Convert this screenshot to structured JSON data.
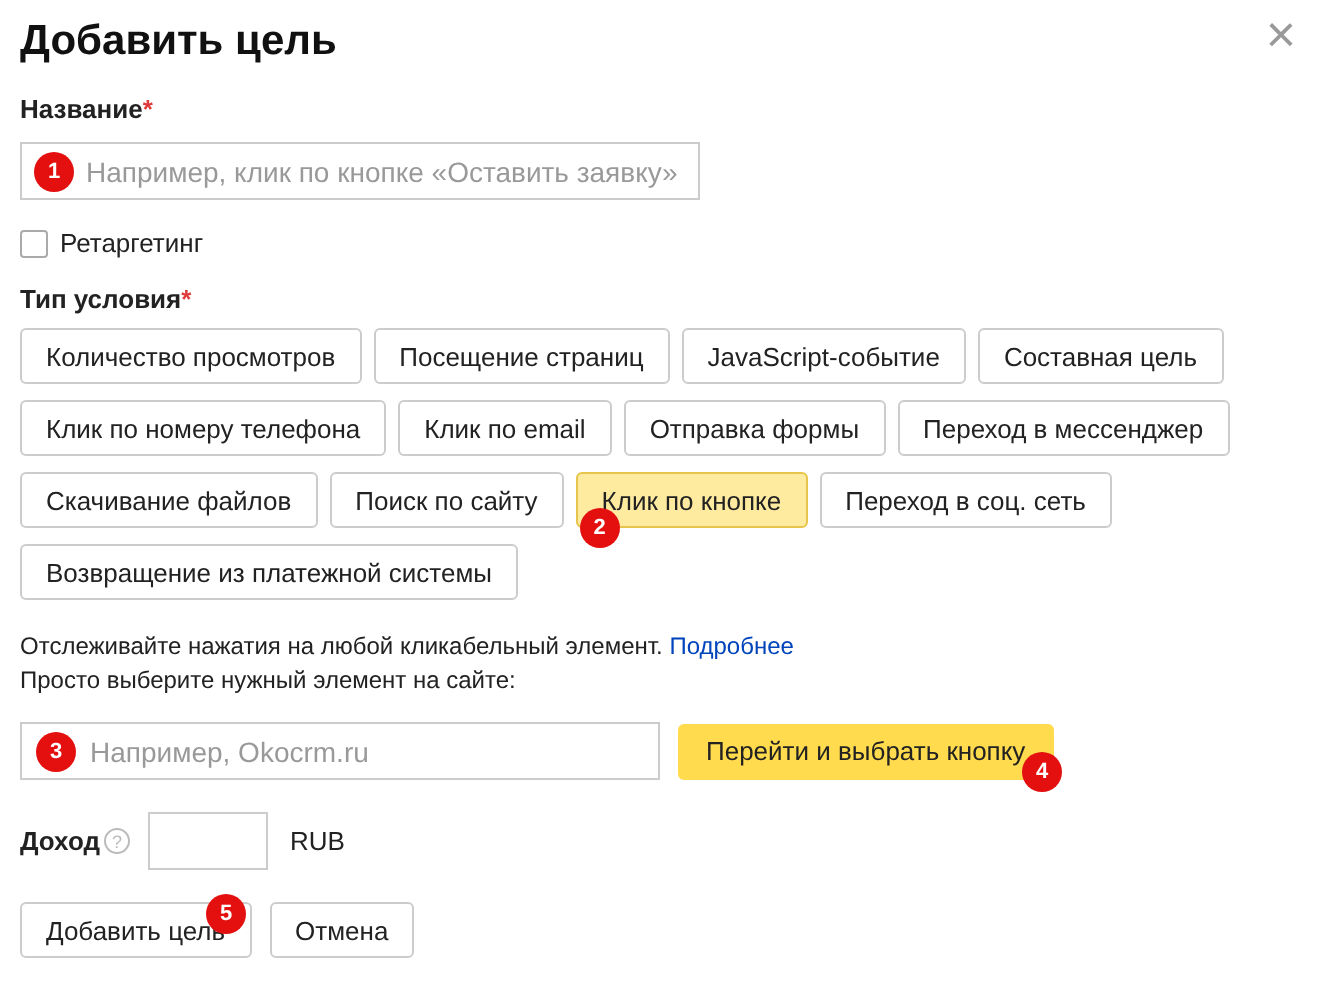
{
  "dialog": {
    "title": "Добавить цель",
    "close_icon": "×"
  },
  "name_field": {
    "label": "Название",
    "required_mark": "*",
    "placeholder": "Например, клик по кнопке «Оставить заявку»",
    "marker": "1"
  },
  "retargeting": {
    "label": "Ретаргетинг",
    "checked": false
  },
  "condition_type": {
    "label": "Тип условия",
    "required_mark": "*",
    "options": [
      {
        "label": "Количество просмотров",
        "selected": false
      },
      {
        "label": "Посещение страниц",
        "selected": false
      },
      {
        "label": "JavaScript-событие",
        "selected": false
      },
      {
        "label": "Составная цель",
        "selected": false
      },
      {
        "label": "Клик по номеру телефона",
        "selected": false
      },
      {
        "label": "Клик по email",
        "selected": false
      },
      {
        "label": "Отправка формы",
        "selected": false
      },
      {
        "label": "Переход в мессенджер",
        "selected": false
      },
      {
        "label": "Скачивание файлов",
        "selected": false
      },
      {
        "label": "Поиск по сайту",
        "selected": false
      },
      {
        "label": "Клик по кнопке",
        "selected": true,
        "marker": "2"
      },
      {
        "label": "Переход в соц. сеть",
        "selected": false
      },
      {
        "label": "Возвращение из платежной системы",
        "selected": false
      }
    ]
  },
  "hint": {
    "text": "Отслеживайте нажатия на любой кликабельный элемент.",
    "link": "Подробнее",
    "text2": "Просто выберите нужный элемент на сайте:"
  },
  "site_field": {
    "placeholder": "Например, Okocrm.ru",
    "marker": "3"
  },
  "pick_button": {
    "label": "Перейти и выбрать кнопку",
    "marker": "4"
  },
  "income": {
    "label": "Доход",
    "help_icon": "?",
    "currency": "RUB"
  },
  "buttons": [
    {
      "label": "Добавить цель",
      "marker": "5"
    },
    {
      "label": "Отмена"
    }
  ]
}
